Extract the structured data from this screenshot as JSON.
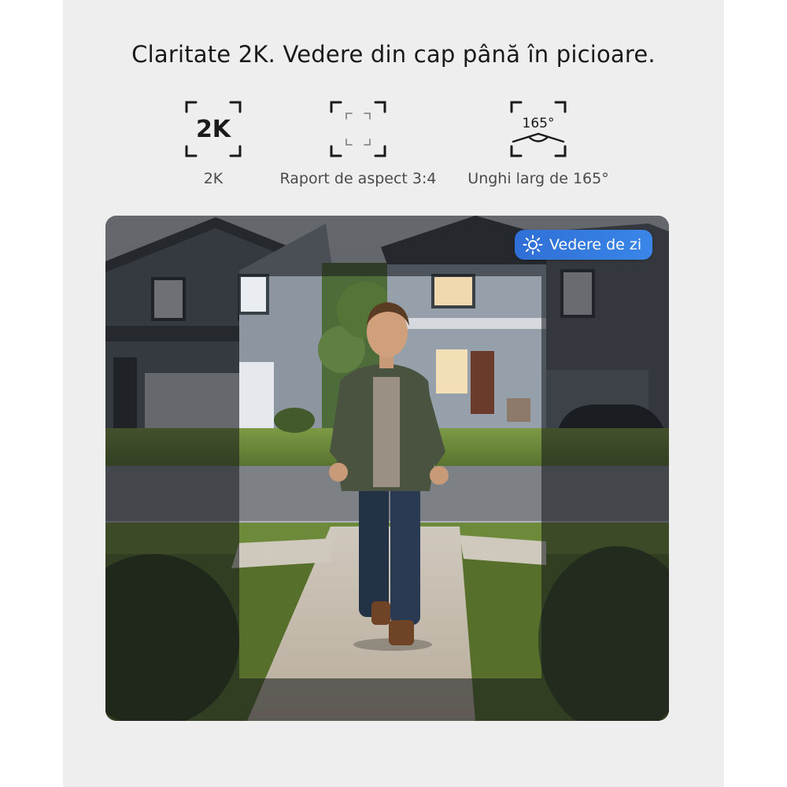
{
  "headline": "Claritate 2K. Vedere din cap până în picioare.",
  "features": [
    {
      "icon": "resolution-2k-icon",
      "icon_text": "2K",
      "label": "2K"
    },
    {
      "icon": "aspect-ratio-icon",
      "label": "Raport de aspect 3:4"
    },
    {
      "icon": "wide-angle-icon",
      "icon_text": "165°",
      "label": "Unghi larg de 165°"
    }
  ],
  "preview": {
    "badge_icon": "sun-icon",
    "badge_label": "Vedere de zi"
  },
  "colors": {
    "panel_background": "#efeeef",
    "headline_text": "#1a1a1a",
    "label_text": "#4a4a4a",
    "badge_background": "#2f6fd6",
    "badge_text": "#ffffff"
  }
}
